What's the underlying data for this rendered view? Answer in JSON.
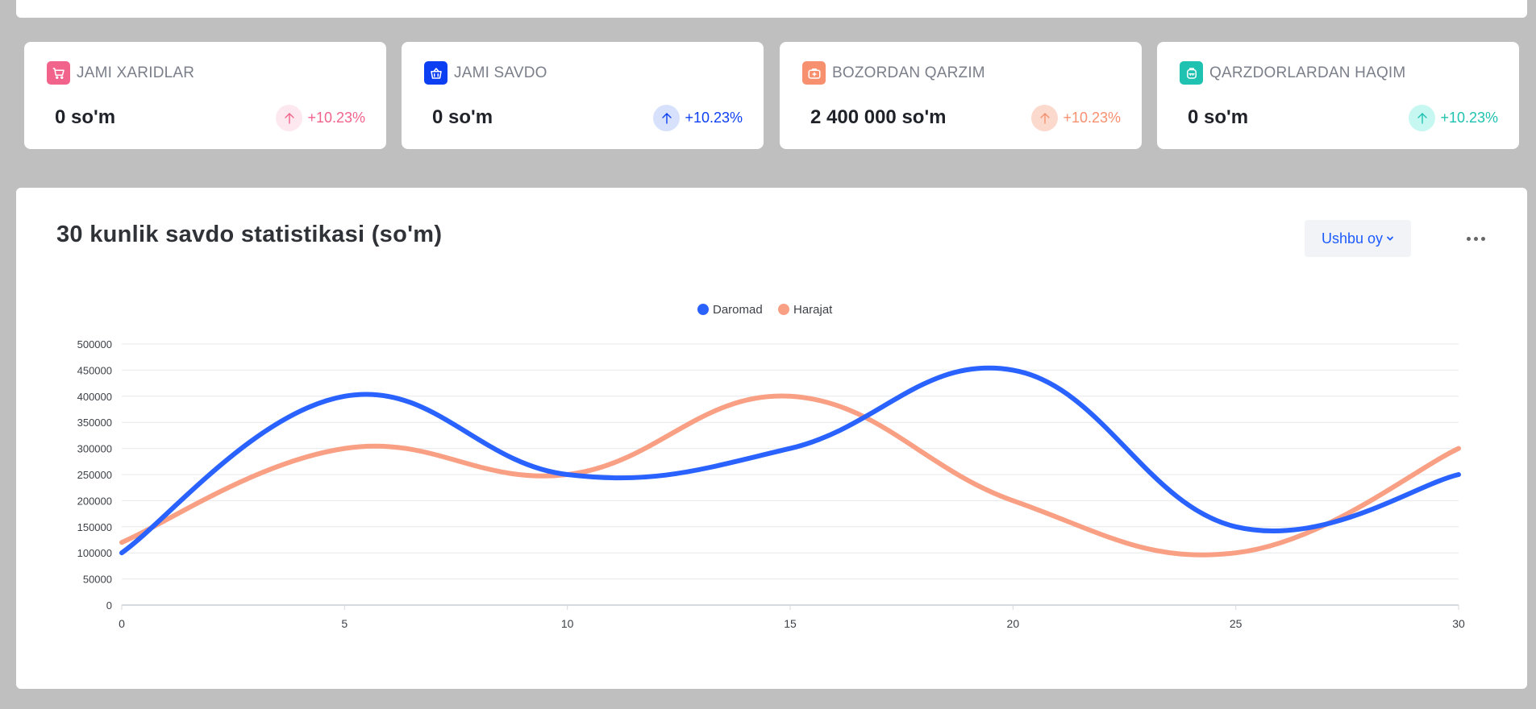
{
  "stats": [
    {
      "title": "JAMI XARIDLAR",
      "value": "0 so'm",
      "change": "+10.23%",
      "color": "#f2638c",
      "soft": "#fde8ef",
      "icon": "cart-icon"
    },
    {
      "title": "JAMI SAVDO",
      "value": "0 so'm",
      "change": "+10.23%",
      "color": "#0c3ff2",
      "soft": "#d7e1fb",
      "icon": "basket-icon"
    },
    {
      "title": "BOZORDAN QARZIM",
      "value": "2 400 000 so'm",
      "change": "+10.23%",
      "color": "#f7906f",
      "soft": "#fcd9cd",
      "icon": "bag-icon"
    },
    {
      "title": "QARZDORLARDAN HAQIM",
      "value": "0 so'm",
      "change": "+10.23%",
      "color": "#1fc2b0",
      "soft": "#c6f7f1",
      "icon": "backpack-icon"
    }
  ],
  "chart_panel": {
    "title": "30 kunlik savdo statistikasi (so'm)",
    "period_label": "Ushbu oy"
  },
  "chart_data": {
    "type": "line",
    "x": [
      0,
      5,
      10,
      15,
      20,
      25,
      30
    ],
    "series": [
      {
        "name": "Daromad",
        "color": "#2962ff",
        "values": [
          100000,
          400000,
          250000,
          300000,
          450000,
          150000,
          250000
        ]
      },
      {
        "name": "Harajat",
        "color": "#f9a084",
        "values": [
          120000,
          300000,
          250000,
          400000,
          200000,
          100000,
          300000
        ]
      }
    ],
    "xlim": [
      0,
      30
    ],
    "ylim": [
      0,
      500000
    ],
    "yticks": [
      0,
      50000,
      100000,
      150000,
      200000,
      250000,
      300000,
      350000,
      400000,
      450000,
      500000
    ],
    "xticks": [
      0,
      5,
      10,
      15,
      20,
      25,
      30
    ],
    "grid": true,
    "legend": "top-center"
  }
}
